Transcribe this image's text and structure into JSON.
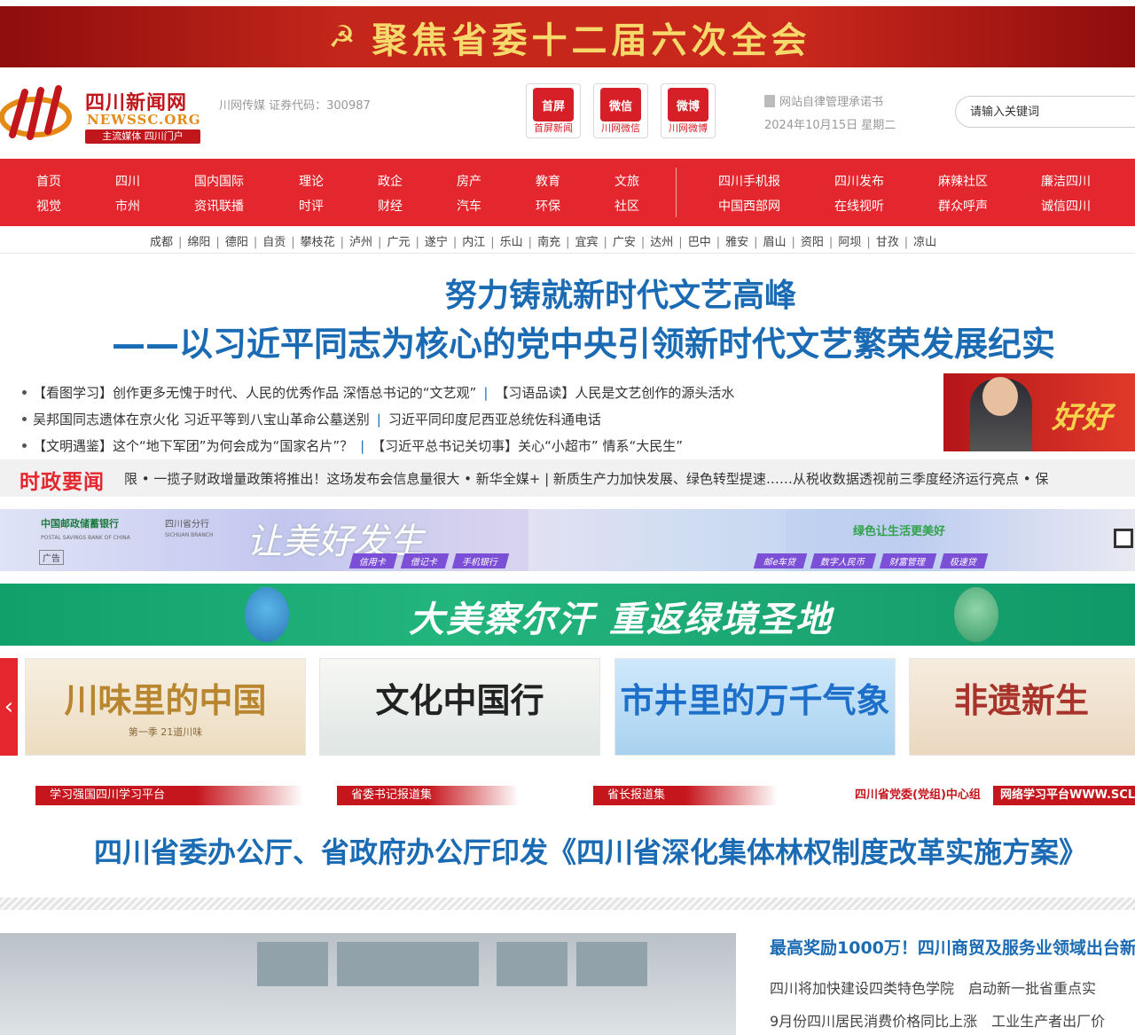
{
  "top_banner": {
    "text": "聚焦省委十二届六次全会",
    "emblem": "hammer-sickle-icon"
  },
  "header": {
    "logo_name": "四川新闻网",
    "logo_domain": "NEWSSC.ORG",
    "logo_slogan": "主流媒体 四川门户",
    "stock": "川网传媒 证券代码：300987",
    "apps": [
      {
        "label": "首屏新闻",
        "pic": "首屏"
      },
      {
        "label": "川网微信",
        "pic": "微信"
      },
      {
        "label": "川网微博",
        "pic": "微博"
      }
    ],
    "commitment": "网站自律管理承诺书",
    "date": "2024年10月15日 星期二",
    "search_placeholder": "请输入关键词"
  },
  "nav": {
    "columns": [
      [
        "首页",
        "视觉"
      ],
      [
        "四川",
        "市州"
      ],
      [
        "国内国际",
        "资讯联播"
      ],
      [
        "理论",
        "时评"
      ],
      [
        "政企",
        "财经"
      ],
      [
        "房产",
        "汽车"
      ],
      [
        "教育",
        "环保"
      ],
      [
        "文旅",
        "社区"
      ],
      [
        "四川手机报",
        "中国西部网"
      ],
      [
        "四川发布",
        "在线视听"
      ],
      [
        "麻辣社区",
        "群众呼声"
      ],
      [
        "廉洁四川",
        "诚信四川"
      ]
    ]
  },
  "cities": [
    "成都",
    "绵阳",
    "德阳",
    "自贡",
    "攀枝花",
    "泸州",
    "广元",
    "遂宁",
    "内江",
    "乐山",
    "南充",
    "宜宾",
    "广安",
    "达州",
    "巴中",
    "雅安",
    "眉山",
    "资阳",
    "阿坝",
    "甘孜",
    "凉山"
  ],
  "headline": {
    "line1": "努力铸就新时代文艺高峰",
    "line2": "——以习近平同志为核心的党中央引领新时代文艺繁荣发展纪实"
  },
  "bullets": [
    [
      "【看图学习】创作更多无愧于时代、人民的优秀作品 深悟总书记的“文艺观”",
      "【习语品读】人民是文艺创作的源头活水"
    ],
    [
      "吴邦国同志遗体在京火化 习近平等到八宝山革命公墓送别",
      "习近平同印度尼西亚总统佐科通电话"
    ],
    [
      "【文明遇鉴】这个“地下军团”为何会成为“国家名片”？",
      "【习近平总书记关切事】关心“小超市” 情系“大民生”"
    ]
  ],
  "right_pic_tag": "好好",
  "ticker": {
    "label": "时政要闻",
    "text": "限  • 一揽子财政增量政策将推出！这场发布会信息量很大  • 新华全媒+ | 新质生产力加快发展、绿色转型提速……从税收数据透视前三季度经济运行亮点  • 保"
  },
  "ad1": {
    "bank": "中国邮政储蓄银行",
    "bank_en": "POSTAL SAVINGS BANK OF CHINA",
    "branch": "四川省分行",
    "branch_en": "SICHUAN BRANCH",
    "slogan": "让美好发生",
    "ad_tag": "广告",
    "green_slogan": "绿色让生活更美好",
    "chips_left": [
      "信用卡",
      "借记卡",
      "手机银行"
    ],
    "chips_right": [
      "邮e车贷",
      "数字人民币",
      "财富管理",
      "极速贷"
    ]
  },
  "ad2": {
    "title": "大美察尔汗 重返绿境圣地"
  },
  "carousel": [
    {
      "title": "川味里的中国",
      "sub": "第一季 21道川味",
      "color": "#b8862e"
    },
    {
      "title": "文化中国行",
      "sub": "",
      "color": "#222222"
    },
    {
      "title": "市井里的万千气象",
      "sub": "",
      "color": "#1d6fc9"
    },
    {
      "title": "非遗新生",
      "sub": "",
      "color": "#a8332a"
    }
  ],
  "sub_labels": [
    "学习强国四川学习平台",
    "省委书记报道集",
    "省长报道集",
    "四川省党委(党组)中心组",
    "网络学习平台WWW.SCL"
  ],
  "big_headline": "四川省委办公厅、省政府办公厅印发《四川省深化集体林权制度改革实施方案》",
  "news_right": [
    "最高奖励1000万！四川商贸及服务业领域出台新",
    "四川将加快建设四类特色学院　启动新一批省重点实",
    "9月份四川居民消费价格同比上涨　工业生产者出厂价"
  ],
  "colors": {
    "brand_red": "#e4272e",
    "headline_blue": "#1a6bb4",
    "banner_gold": "#f7d96b"
  }
}
